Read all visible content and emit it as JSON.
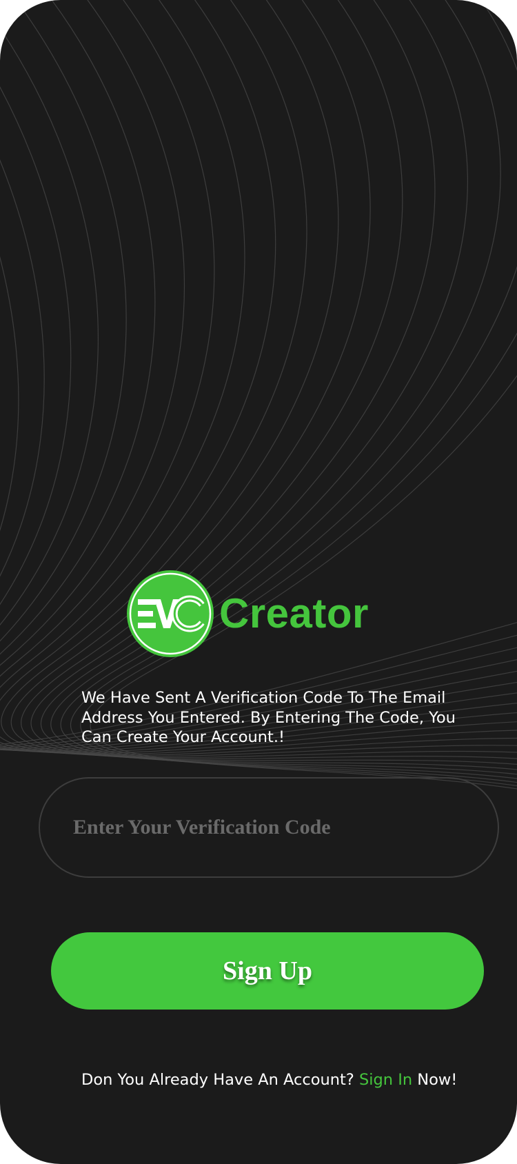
{
  "brand": {
    "logo_word": "Creator",
    "logo_monogram": "EVC",
    "accent_color": "#45c53d",
    "background_color": "#1b1b1b"
  },
  "verification": {
    "message": "We Have Sent A Verification Code To The Email Address You Entered. By Entering The Code, You Can Create Your Account.!",
    "code_placeholder": "Enter Your Verification Code",
    "code_value": ""
  },
  "actions": {
    "signup_label": "Sign Up"
  },
  "footer": {
    "prompt_text": "Don You Already Have An Account?",
    "signin_link": "Sign In",
    "suffix_text": "Now!"
  }
}
